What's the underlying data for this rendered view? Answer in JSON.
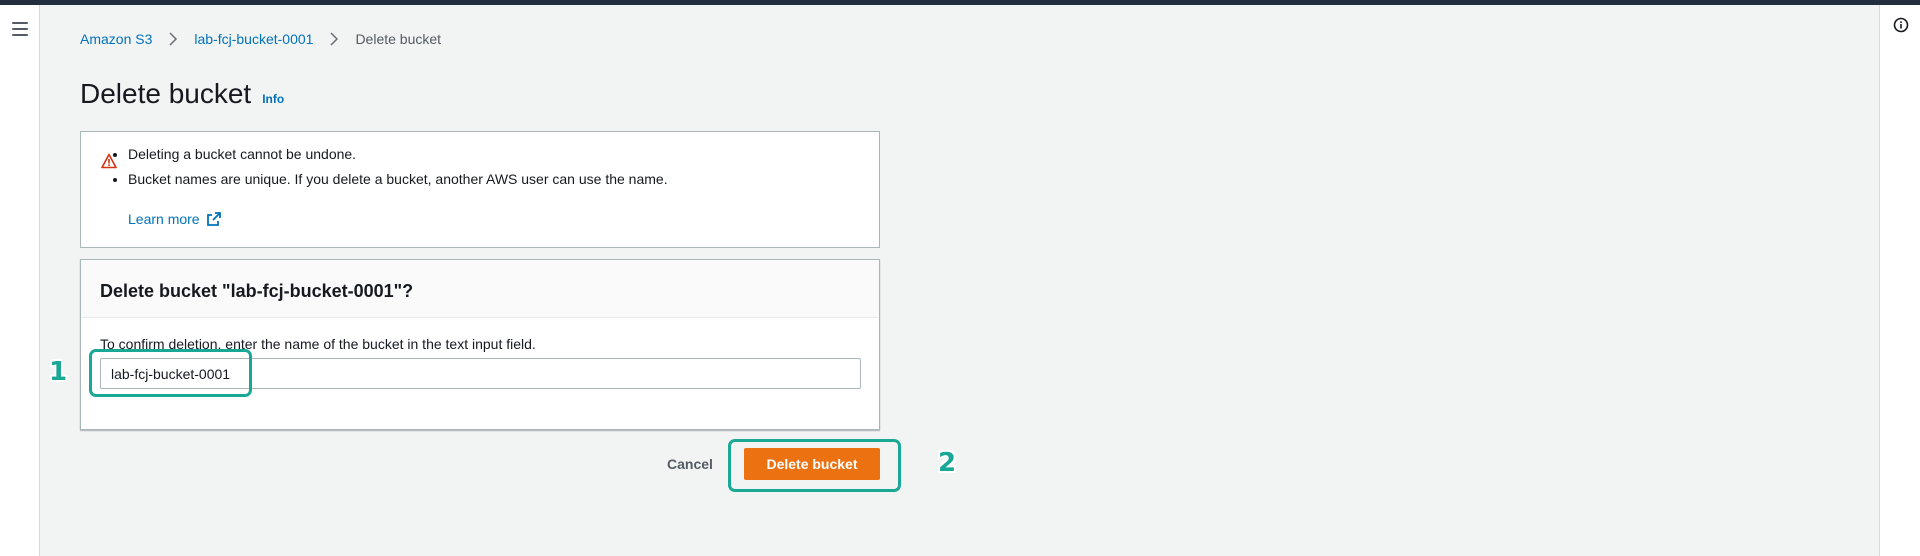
{
  "breadcrumb": {
    "items": [
      {
        "label": "Amazon S3"
      },
      {
        "label": "lab-fcj-bucket-0001"
      },
      {
        "label": "Delete bucket"
      }
    ]
  },
  "page": {
    "title": "Delete bucket",
    "info_label": "Info"
  },
  "alert": {
    "bullets": [
      "Deleting a bucket cannot be undone.",
      "Bucket names are unique. If you delete a bucket, another AWS user can use the name."
    ],
    "learn_more": "Learn more"
  },
  "confirm": {
    "heading": "Delete bucket \"lab-fcj-bucket-0001\"?",
    "label": "To confirm deletion, enter the name of the bucket in the text input field.",
    "input_value": "lab-fcj-bucket-0001"
  },
  "actions": {
    "cancel": "Cancel",
    "delete": "Delete bucket"
  },
  "annotations": {
    "step1": "1",
    "step2": "2"
  },
  "colors": {
    "primary_button": "#ec7211",
    "link": "#0073bb",
    "annotation": "#1aa896",
    "warning_icon": "#d13212"
  }
}
